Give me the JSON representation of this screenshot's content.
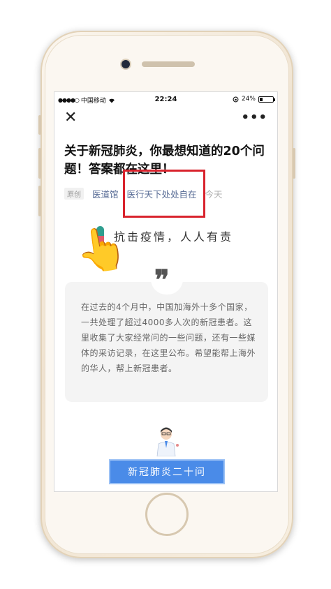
{
  "status_bar": {
    "signal": "●●●●○",
    "carrier": "中国移动",
    "wifi_icon": "wifi-icon",
    "time": "22:24",
    "battery_percent": "24%",
    "battery_level": 0.24
  },
  "nav": {
    "close_label": "✕",
    "more_label": "•••"
  },
  "article": {
    "title": "关于新冠肺炎，你最想知道的20个问题！答案都在这里！",
    "tag_original": "原创",
    "author": "医道馆",
    "account": "医行天下处处自在",
    "date": "今天",
    "slogan": "抗击疫情，人人有责",
    "quote_mark": "❞",
    "quote_text": "在过去的4个月中，中国加海外十多个国家，一共处理了超过4000多人次的新冠患者。这里收集了大家经常问的一些问题，还有一些媒体的采访记录，在这里公布。希望能帮上海外的华人，帮上新冠患者。",
    "cta_label": "新冠肺炎二十问"
  },
  "overlay": {
    "pointer": "👆"
  },
  "colors": {
    "link": "#576b95",
    "highlight": "#d9232d",
    "cta": "#4a8be8"
  }
}
